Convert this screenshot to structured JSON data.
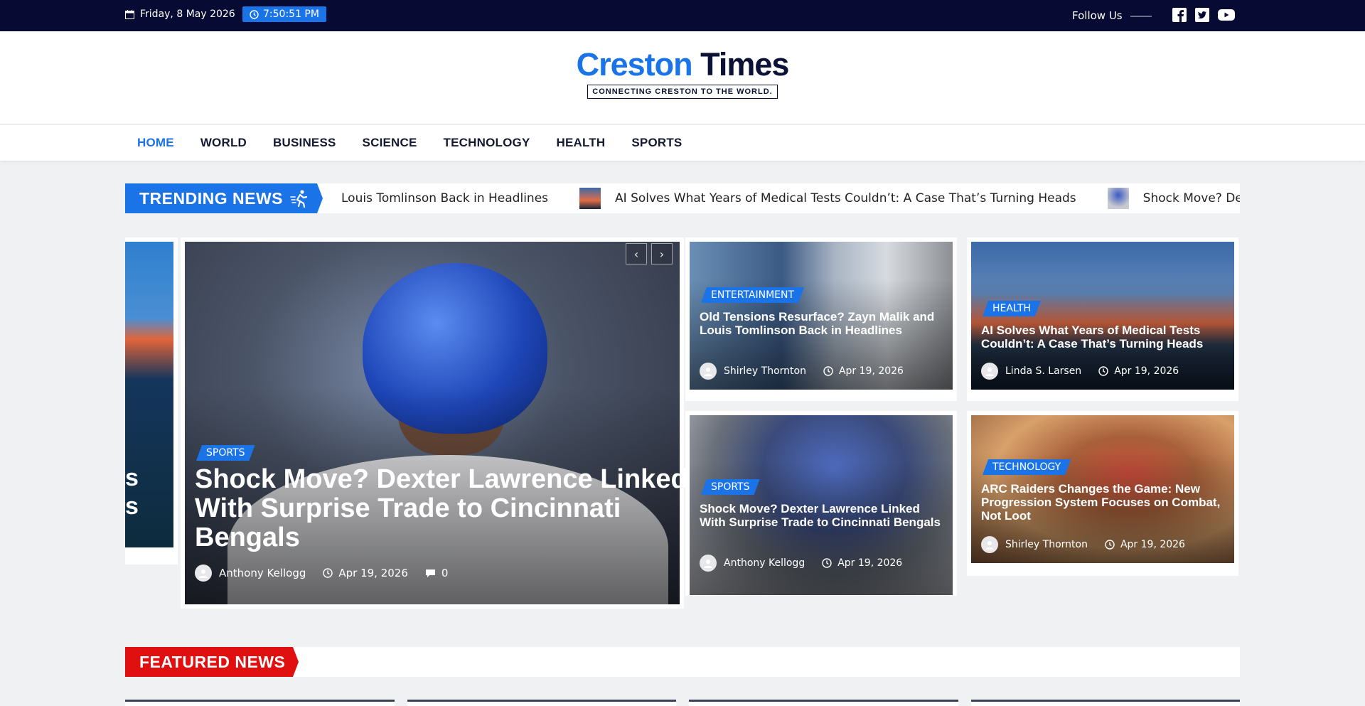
{
  "topbar": {
    "date": "Friday, 8 May 2026",
    "time": "7:50:51 PM",
    "follow_label": "Follow Us",
    "social": [
      "facebook-icon",
      "twitter-icon",
      "youtube-icon"
    ]
  },
  "logo": {
    "part1": "Creston",
    "part2": "Times",
    "tagline": "CONNECTING CRESTON TO THE WORLD."
  },
  "nav": {
    "items": [
      "HOME",
      "WORLD",
      "BUSINESS",
      "SCIENCE",
      "TECHNOLOGY",
      "HEALTH",
      "SPORTS"
    ],
    "active": "HOME"
  },
  "trending": {
    "label": "TRENDING NEWS",
    "items": [
      "Louis Tomlinson Back in Headlines",
      "AI Solves What Years of Medical Tests Couldn’t: A Case That’s Turning Heads",
      "Shock Move? De"
    ]
  },
  "slider": {
    "peek_text": "s\ns",
    "main": {
      "category": "SPORTS",
      "title": "Shock Move? Dexter Lawrence Linked With Surprise Trade to Cincinnati Bengals",
      "author": "Anthony Kellogg",
      "date": "Apr 19, 2026",
      "comments": "0"
    }
  },
  "cards": [
    {
      "category": "ENTERTAINMENT",
      "title": "Old Tensions Resurface? Zayn Malik and Louis Tomlinson Back in Headlines",
      "author": "Shirley Thornton",
      "date": "Apr 19, 2026"
    },
    {
      "category": "HEALTH",
      "title": "AI Solves What Years of Medical Tests Couldn’t: A Case That’s Turning Heads",
      "author": "Linda S. Larsen",
      "date": "Apr 19, 2026"
    },
    {
      "category": "SPORTS",
      "title": "Shock Move? Dexter Lawrence Linked With Surprise Trade to Cincinnati Bengals",
      "author": "Anthony Kellogg",
      "date": "Apr 19, 2026"
    },
    {
      "category": "TECHNOLOGY",
      "title": "ARC Raiders Changes the Game: New Progression System Focuses on Combat, Not Loot",
      "author": "Shirley Thornton",
      "date": "Apr 19, 2026"
    }
  ],
  "featured": {
    "label": "FEATURED NEWS"
  },
  "colors": {
    "accent": "#1a74e8",
    "topbar_bg": "#070b33",
    "featured_red": "#e01010"
  }
}
